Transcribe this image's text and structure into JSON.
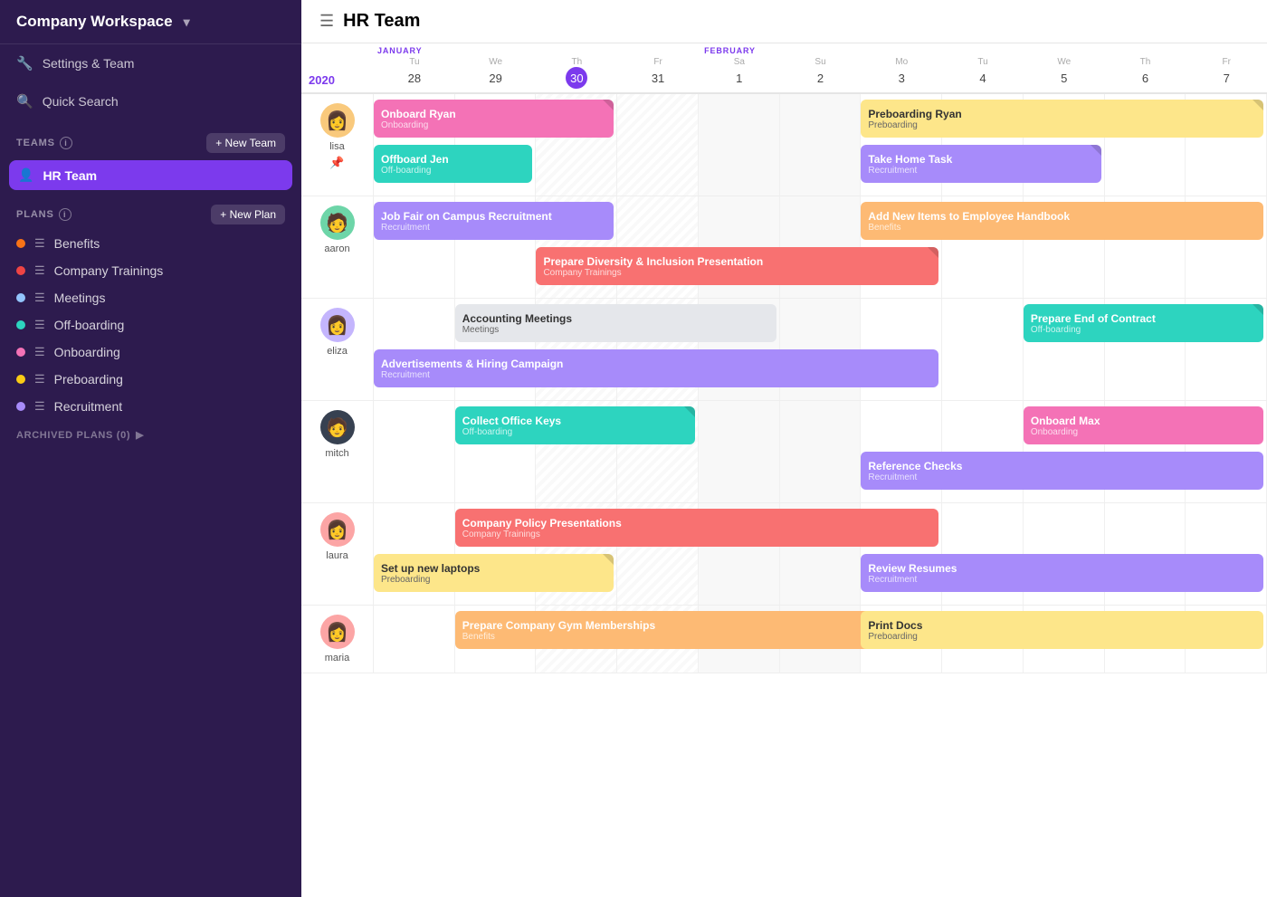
{
  "sidebar": {
    "workspace": "Company Workspace",
    "settings_label": "Settings & Team",
    "search_label": "Quick Search",
    "teams_section": "TEAMS",
    "new_team_btn": "+ New Team",
    "active_team": "HR Team",
    "plans_section": "PLANS",
    "new_plan_btn": "+ New Plan",
    "plans": [
      {
        "name": "Benefits",
        "color": "#f97316",
        "id": "benefits"
      },
      {
        "name": "Company Trainings",
        "color": "#ef4444",
        "id": "company-trainings"
      },
      {
        "name": "Meetings",
        "color": "#93c5fd",
        "id": "meetings"
      },
      {
        "name": "Off-boarding",
        "color": "#2dd4bf",
        "id": "offboarding"
      },
      {
        "name": "Onboarding",
        "color": "#f472b6",
        "id": "onboarding"
      },
      {
        "name": "Preboarding",
        "color": "#facc15",
        "id": "preboarding"
      },
      {
        "name": "Recruitment",
        "color": "#a78bfa",
        "id": "recruitment"
      }
    ],
    "archived_label": "ARCHIVED PLANS (0)"
  },
  "header": {
    "title": "HR Team"
  },
  "calendar": {
    "year": "2020",
    "months": [
      {
        "label": "JANUARY",
        "span": 4
      },
      {
        "label": "FEBRUARY",
        "span": 7
      }
    ],
    "days": [
      {
        "name": "Tu",
        "num": "28",
        "today": false,
        "weekend": false,
        "shaded": false
      },
      {
        "name": "We",
        "num": "29",
        "today": false,
        "weekend": false,
        "shaded": false
      },
      {
        "name": "Th",
        "num": "30",
        "today": true,
        "weekend": false,
        "shaded": true
      },
      {
        "name": "Fr",
        "num": "31",
        "today": false,
        "weekend": false,
        "shaded": true
      },
      {
        "name": "Sa",
        "num": "1",
        "today": false,
        "weekend": true,
        "shaded": false
      },
      {
        "name": "Su",
        "num": "2",
        "today": false,
        "weekend": true,
        "shaded": false
      },
      {
        "name": "Mo",
        "num": "3",
        "today": false,
        "weekend": false,
        "shaded": false
      },
      {
        "name": "Tu",
        "num": "4",
        "today": false,
        "weekend": false,
        "shaded": false
      },
      {
        "name": "We",
        "num": "5",
        "today": false,
        "weekend": false,
        "shaded": false
      },
      {
        "name": "Th",
        "num": "6",
        "today": false,
        "weekend": false,
        "shaded": false
      },
      {
        "name": "Fr",
        "num": "7",
        "today": false,
        "weekend": false,
        "shaded": false
      }
    ],
    "col_count": 11
  },
  "people": [
    {
      "name": "lisa",
      "avatar_color": "#f9c97c",
      "avatar_emoji": "👩",
      "pinned": true,
      "tasks": [
        {
          "title": "Onboard Ryan",
          "plan": "Onboarding",
          "color": "#f472b6",
          "start": 0,
          "span": 3,
          "row": 0,
          "corner": true
        },
        {
          "title": "Preboarding Ryan",
          "plan": "Preboarding",
          "color": "#fde68a",
          "text_dark": true,
          "start": 6,
          "span": 5,
          "row": 0,
          "corner": true
        },
        {
          "title": "Offboard Jen",
          "plan": "Off-boarding",
          "color": "#2dd4bf",
          "start": 0,
          "span": 2,
          "row": 1
        },
        {
          "title": "Take Home Task",
          "plan": "Recruitment",
          "color": "#a78bfa",
          "start": 6,
          "span": 3,
          "row": 1,
          "corner": true
        }
      ]
    },
    {
      "name": "aaron",
      "avatar_color": "#6dd5a8",
      "avatar_emoji": "🧑",
      "pinned": false,
      "tasks": [
        {
          "title": "Job Fair on Campus Recruitment",
          "plan": "Recruitment",
          "color": "#a78bfa",
          "start": 0,
          "span": 3,
          "row": 0,
          "corner": false
        },
        {
          "title": "Add New Items to Employee Handbook",
          "plan": "Benefits",
          "color": "#fdba74",
          "start": 6,
          "span": 5,
          "row": 0
        },
        {
          "title": "Prepare Diversity & Inclusion Presentation",
          "plan": "Company Trainings",
          "color": "#f87171",
          "start": 2,
          "span": 5,
          "row": 1,
          "corner": true
        }
      ]
    },
    {
      "name": "eliza",
      "avatar_color": "#c4b5fd",
      "avatar_emoji": "👩",
      "pinned": false,
      "tasks": [
        {
          "title": "Accounting Meetings",
          "plan": "Meetings",
          "color": "#e5e7eb",
          "text_dark": true,
          "start": 1,
          "span": 4,
          "row": 0
        },
        {
          "title": "Prepare End of Contract",
          "plan": "Off-boarding",
          "color": "#2dd4bf",
          "start": 8,
          "span": 3,
          "row": 0,
          "corner": true
        },
        {
          "title": "Advertisements & Hiring Campaign",
          "plan": "Recruitment",
          "color": "#a78bfa",
          "start": 0,
          "span": 7,
          "row": 1
        }
      ]
    },
    {
      "name": "mitch",
      "avatar_color": "#374151",
      "avatar_emoji": "🧑",
      "pinned": false,
      "tasks": [
        {
          "title": "Collect Office Keys",
          "plan": "Off-boarding",
          "color": "#2dd4bf",
          "start": 1,
          "span": 3,
          "row": 0,
          "corner": true
        },
        {
          "title": "Onboard Max",
          "plan": "Onboarding",
          "color": "#f472b6",
          "start": 8,
          "span": 3,
          "row": 0
        },
        {
          "title": "Reference Checks",
          "plan": "Recruitment",
          "color": "#a78bfa",
          "start": 6,
          "span": 5,
          "row": 1
        }
      ]
    },
    {
      "name": "laura",
      "avatar_color": "#fca5a5",
      "avatar_emoji": "👩",
      "pinned": false,
      "tasks": [
        {
          "title": "Company Policy Presentations",
          "plan": "Company Trainings",
          "color": "#f87171",
          "start": 1,
          "span": 6,
          "row": 0
        },
        {
          "title": "Set up new laptops",
          "plan": "Preboarding",
          "color": "#fde68a",
          "text_dark": true,
          "start": 0,
          "span": 3,
          "row": 1,
          "corner": true
        },
        {
          "title": "Review Resumes",
          "plan": "Recruitment",
          "color": "#a78bfa",
          "start": 6,
          "span": 5,
          "row": 1
        }
      ]
    },
    {
      "name": "maria",
      "avatar_color": "#fca5a5",
      "avatar_emoji": "👩",
      "pinned": false,
      "tasks": [
        {
          "title": "Prepare Company Gym Memberships",
          "plan": "Benefits",
          "color": "#fdba74",
          "start": 1,
          "span": 6,
          "row": 0
        },
        {
          "title": "Print Docs",
          "plan": "Preboarding",
          "color": "#fde68a",
          "text_dark": true,
          "start": 6,
          "span": 5,
          "row": 0
        }
      ]
    }
  ],
  "colors": {
    "sidebar_bg": "#2d1b4e",
    "accent": "#7c3aed",
    "today_bg": "#7c3aed"
  }
}
